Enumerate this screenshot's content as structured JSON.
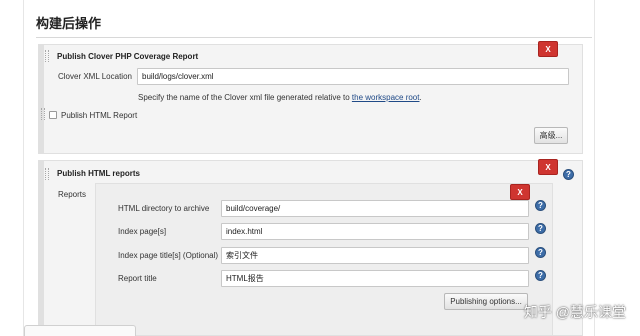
{
  "section": {
    "title": "构建后操作"
  },
  "clover": {
    "title": "Publish Clover PHP Coverage Report",
    "delete_label": "X",
    "xml_location": {
      "label": "Clover XML Location",
      "value": "build/logs/clover.xml",
      "hint_prefix": "Specify the name of the Clover xml file generated relative to ",
      "hint_link": "the workspace root",
      "hint_suffix": "."
    },
    "publish_html": {
      "label": "Publish HTML Report",
      "checked": false
    },
    "advanced_label": "高级..."
  },
  "html_reports": {
    "title": "Publish HTML reports",
    "delete_label": "X",
    "reports_label": "Reports",
    "report": {
      "delete_label": "X",
      "fields": [
        {
          "label": "HTML directory to archive",
          "value": "build/coverage/"
        },
        {
          "label": "Index page[s]",
          "value": "index.html"
        },
        {
          "label": "Index page title[s] (Optional)",
          "value": "索引文件"
        },
        {
          "label": "Report title",
          "value": "HTML报告"
        }
      ],
      "publishing_label": "Publishing options..."
    }
  },
  "help_icon_glyph": "?",
  "watermark": "知乎 @慧乐课堂",
  "colors": {
    "delete_button": "#cf3530",
    "help_icon": "#3d6da8",
    "link": "#204a87",
    "block_background": "#f4f4f4"
  }
}
